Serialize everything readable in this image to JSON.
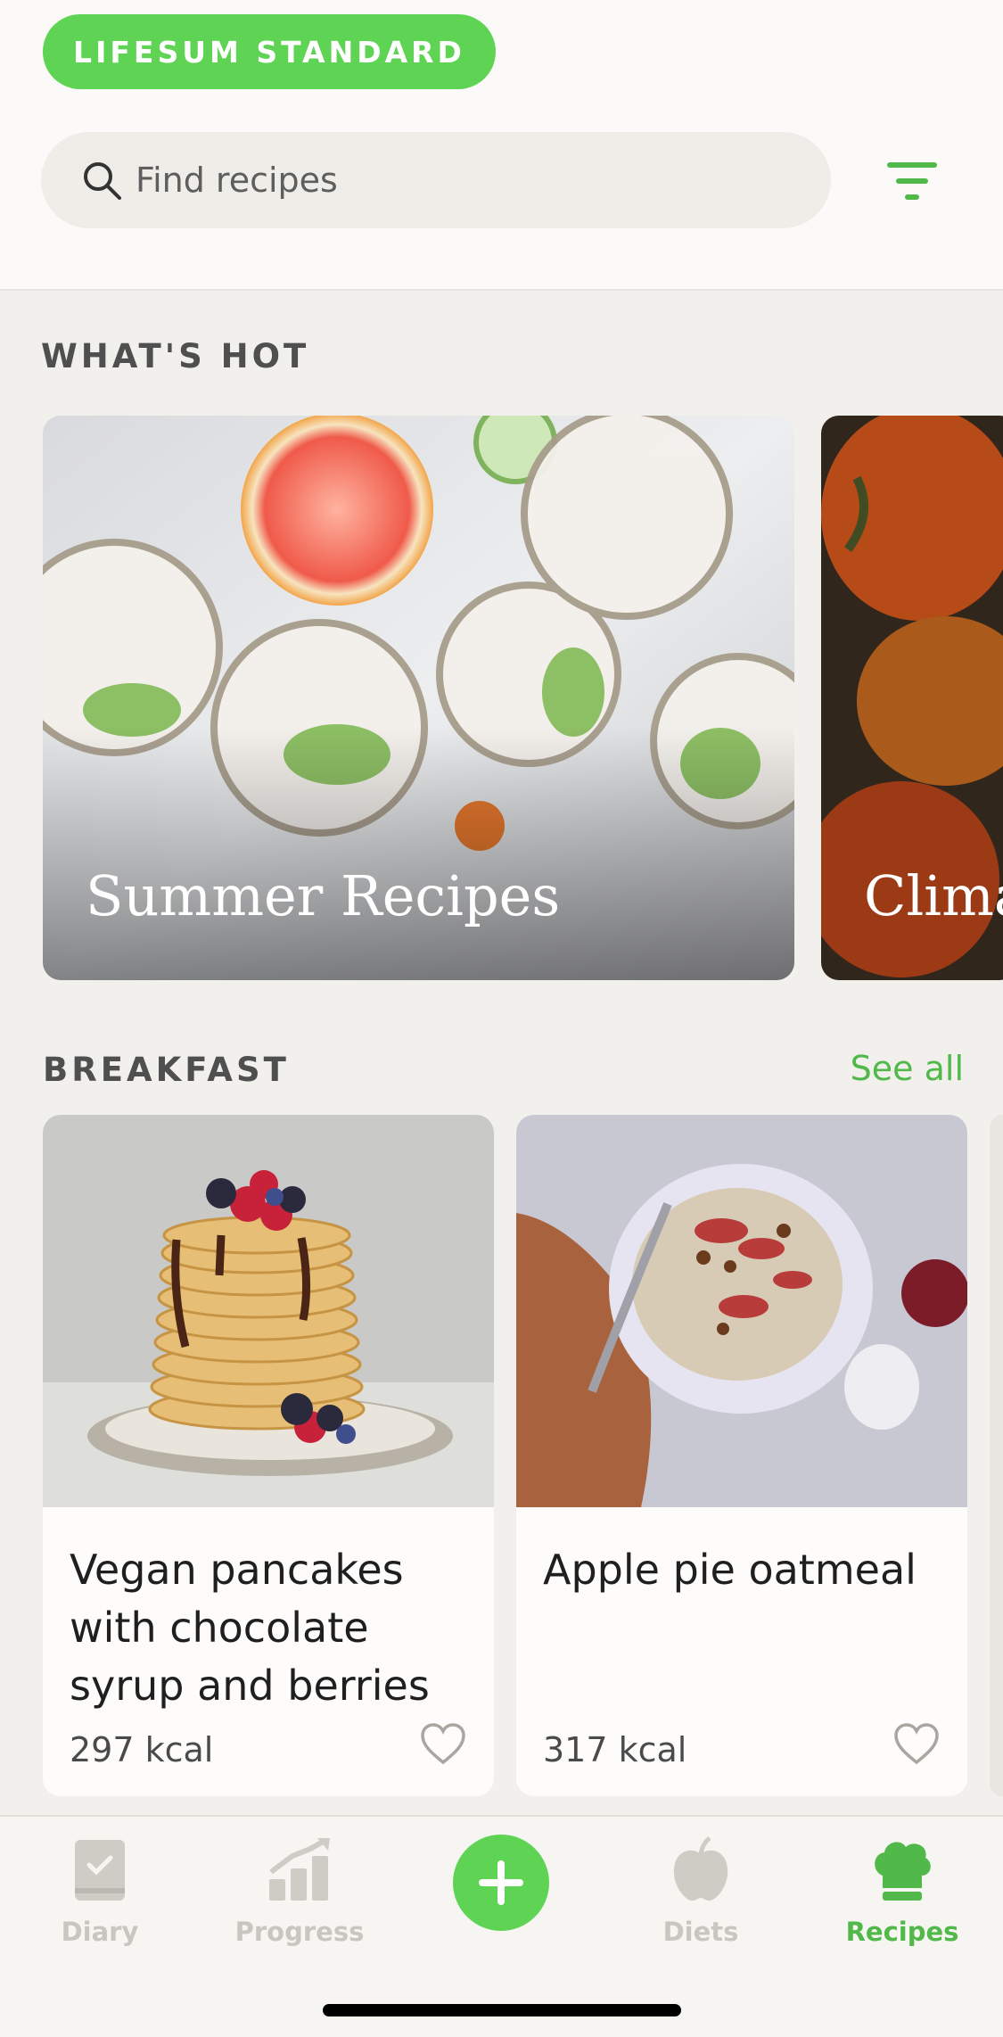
{
  "header": {
    "plan_badge": "LIFESUM STANDARD",
    "search_placeholder": "Find recipes"
  },
  "sections": {
    "whats_hot": {
      "title": "WHAT'S HOT",
      "cards": [
        {
          "title": "Summer Recipes"
        },
        {
          "title": "Clima"
        }
      ]
    },
    "breakfast": {
      "title": "BREAKFAST",
      "see_all": "See all",
      "recipes": [
        {
          "title": "Vegan pancakes with chocolate syrup and berries",
          "kcal": "297 kcal"
        },
        {
          "title": "Apple pie oatmeal",
          "kcal": "317 kcal"
        }
      ]
    }
  },
  "tabbar": {
    "tabs": [
      {
        "label": "Diary",
        "icon": "diary-icon"
      },
      {
        "label": "Progress",
        "icon": "progress-icon"
      },
      {
        "label": "Diets",
        "icon": "apple-icon"
      },
      {
        "label": "Recipes",
        "icon": "chef-hat-icon",
        "active": true
      }
    ],
    "add_icon": "plus-icon"
  },
  "colors": {
    "accent_green": "#5fd454",
    "link_green": "#51b84a",
    "background": "#f2f0ec",
    "inactive_tab": "#c9c6c0"
  }
}
